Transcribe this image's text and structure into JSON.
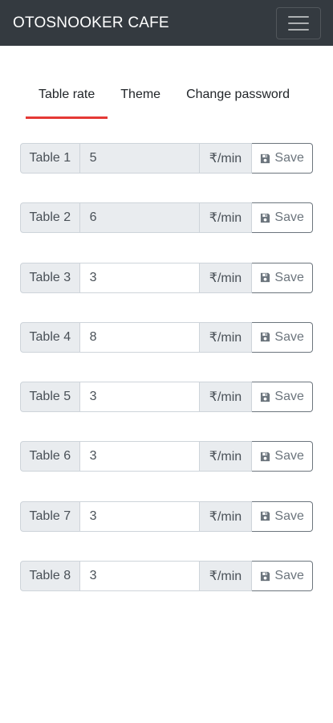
{
  "header": {
    "brand": "OTOSNOOKER CAFE",
    "menu_icon": "hamburger-menu-icon"
  },
  "tabs": [
    {
      "label": "Table rate",
      "active": true
    },
    {
      "label": "Theme",
      "active": false
    },
    {
      "label": "Change password",
      "active": false
    }
  ],
  "colors": {
    "navbar": "#343a40",
    "active_tab_underline": "#e53935",
    "addon_bg": "#e9ecef",
    "button_border": "#6c757d"
  },
  "tables": [
    {
      "label": "Table 1",
      "value": "5",
      "unit": "₹/min",
      "save_label": "Save",
      "disabled": true
    },
    {
      "label": "Table 2",
      "value": "6",
      "unit": "₹/min",
      "save_label": "Save",
      "disabled": true
    },
    {
      "label": "Table 3",
      "value": "3",
      "unit": "₹/min",
      "save_label": "Save",
      "disabled": false
    },
    {
      "label": "Table 4",
      "value": "8",
      "unit": "₹/min",
      "save_label": "Save",
      "disabled": false
    },
    {
      "label": "Table 5",
      "value": "3",
      "unit": "₹/min",
      "save_label": "Save",
      "disabled": false
    },
    {
      "label": "Table 6",
      "value": "3",
      "unit": "₹/min",
      "save_label": "Save",
      "disabled": false
    },
    {
      "label": "Table 7",
      "value": "3",
      "unit": "₹/min",
      "save_label": "Save",
      "disabled": false
    },
    {
      "label": "Table 8",
      "value": "3",
      "unit": "₹/min",
      "save_label": "Save",
      "disabled": false
    }
  ],
  "save_icon": "floppy-disk-icon"
}
